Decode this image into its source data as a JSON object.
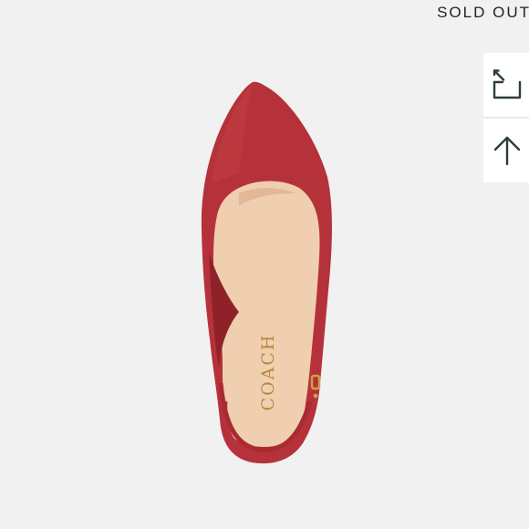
{
  "status": {
    "sold_out_label": "SOLD OUT"
  },
  "toolbar": {
    "buttons": [
      {
        "icon": "share-icon"
      },
      {
        "icon": "arrow-up-icon"
      }
    ],
    "icon_color": "#2c3c3f"
  },
  "product": {
    "brand_logo_text": "COACH",
    "colors": {
      "suede": "#b5323a",
      "suede_dark": "#8f2229",
      "lining": "#f0cfb1",
      "lining_shade": "#e2b896",
      "logo_gold": "#b8893a",
      "buckle_gold": "#c9a24a"
    }
  }
}
